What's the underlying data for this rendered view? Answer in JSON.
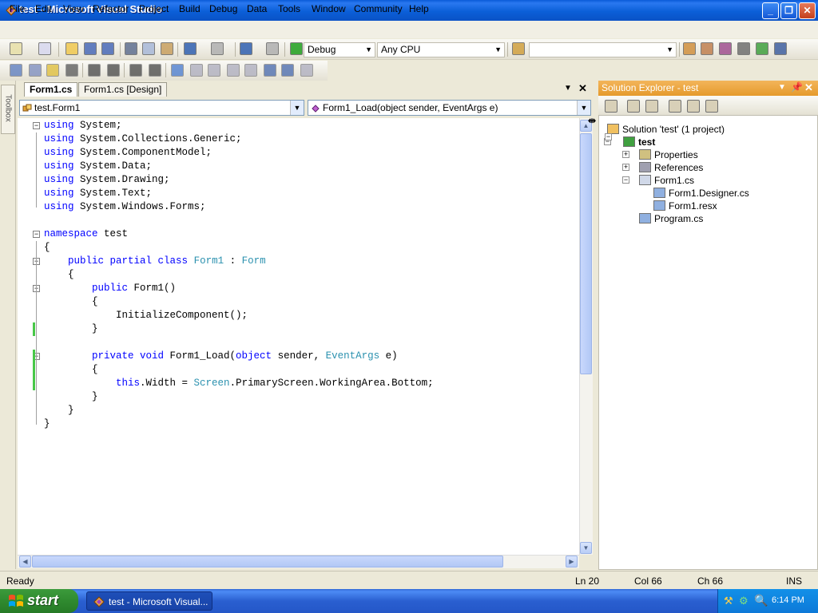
{
  "window": {
    "title": "test - Microsoft Visual Studio"
  },
  "menu": [
    "File",
    "Edit",
    "View",
    "Refactor",
    "Project",
    "Build",
    "Debug",
    "Data",
    "Tools",
    "Window",
    "Community",
    "Help"
  ],
  "toolbar": {
    "config": "Debug",
    "platform": "Any CPU",
    "find_value": ""
  },
  "editor": {
    "tabs": [
      {
        "label": "Form1.cs",
        "active": true
      },
      {
        "label": "Form1.cs [Design]",
        "active": false
      }
    ],
    "class_combo": "test.Form1",
    "member_combo": "Form1_Load(object sender, EventArgs e)",
    "code": [
      [
        [
          "kw",
          "using"
        ],
        [
          "t",
          " System;"
        ]
      ],
      [
        [
          "kw",
          "using"
        ],
        [
          "t",
          " System.Collections.Generic;"
        ]
      ],
      [
        [
          "kw",
          "using"
        ],
        [
          "t",
          " System.ComponentModel;"
        ]
      ],
      [
        [
          "kw",
          "using"
        ],
        [
          "t",
          " System.Data;"
        ]
      ],
      [
        [
          "kw",
          "using"
        ],
        [
          "t",
          " System.Drawing;"
        ]
      ],
      [
        [
          "kw",
          "using"
        ],
        [
          "t",
          " System.Text;"
        ]
      ],
      [
        [
          "kw",
          "using"
        ],
        [
          "t",
          " System.Windows.Forms;"
        ]
      ],
      [],
      [
        [
          "kw",
          "namespace"
        ],
        [
          "t",
          " test"
        ]
      ],
      [
        [
          "t",
          "{"
        ]
      ],
      [
        [
          "t",
          "    "
        ],
        [
          "kw",
          "public partial class"
        ],
        [
          "t",
          " "
        ],
        [
          "ty",
          "Form1"
        ],
        [
          "t",
          " : "
        ],
        [
          "ty",
          "Form"
        ]
      ],
      [
        [
          "t",
          "    {"
        ]
      ],
      [
        [
          "t",
          "        "
        ],
        [
          "kw",
          "public"
        ],
        [
          "t",
          " Form1()"
        ]
      ],
      [
        [
          "t",
          "        {"
        ]
      ],
      [
        [
          "t",
          "            InitializeComponent();"
        ]
      ],
      [
        [
          "t",
          "        }"
        ]
      ],
      [],
      [
        [
          "t",
          "        "
        ],
        [
          "kw",
          "private void"
        ],
        [
          "t",
          " Form1_Load("
        ],
        [
          "kw",
          "object"
        ],
        [
          "t",
          " sender, "
        ],
        [
          "ty",
          "EventArgs"
        ],
        [
          "t",
          " e)"
        ]
      ],
      [
        [
          "t",
          "        {"
        ]
      ],
      [
        [
          "t",
          "            "
        ],
        [
          "kw",
          "this"
        ],
        [
          "t",
          ".Width = "
        ],
        [
          "ty",
          "Screen"
        ],
        [
          "t",
          ".PrimaryScreen.WorkingArea.Bottom;"
        ]
      ],
      [
        [
          "t",
          "        }"
        ]
      ],
      [
        [
          "t",
          "    }"
        ]
      ],
      [
        [
          "t",
          "}"
        ]
      ]
    ]
  },
  "toolbox": {
    "label": "Toolbox"
  },
  "solution_explorer": {
    "title": "Solution Explorer - test",
    "items": [
      {
        "label": "Solution 'test' (1 project)",
        "icon": "solution-icon",
        "bold": false
      },
      {
        "label": "test",
        "icon": "csharp-project-icon",
        "bold": true
      },
      {
        "label": "Properties",
        "icon": "properties-folder-icon",
        "bold": false
      },
      {
        "label": "References",
        "icon": "references-folder-icon",
        "bold": false
      },
      {
        "label": "Form1.cs",
        "icon": "form-icon",
        "bold": false
      },
      {
        "label": "Form1.Designer.cs",
        "icon": "cs-file-icon",
        "bold": false
      },
      {
        "label": "Form1.resx",
        "icon": "resx-file-icon",
        "bold": false
      },
      {
        "label": "Program.cs",
        "icon": "cs-file-icon",
        "bold": false
      }
    ]
  },
  "status": {
    "text": "Ready",
    "ln": "Ln 20",
    "col": "Col 66",
    "ch": "Ch 66",
    "mode": "INS"
  },
  "taskbar": {
    "start": "start",
    "task": "test - Microsoft Visual...",
    "clock": "6:14 PM"
  },
  "colors": {
    "keyword": "#0000ff",
    "type": "#2b91af",
    "title_bar": "#0a5bd8"
  }
}
